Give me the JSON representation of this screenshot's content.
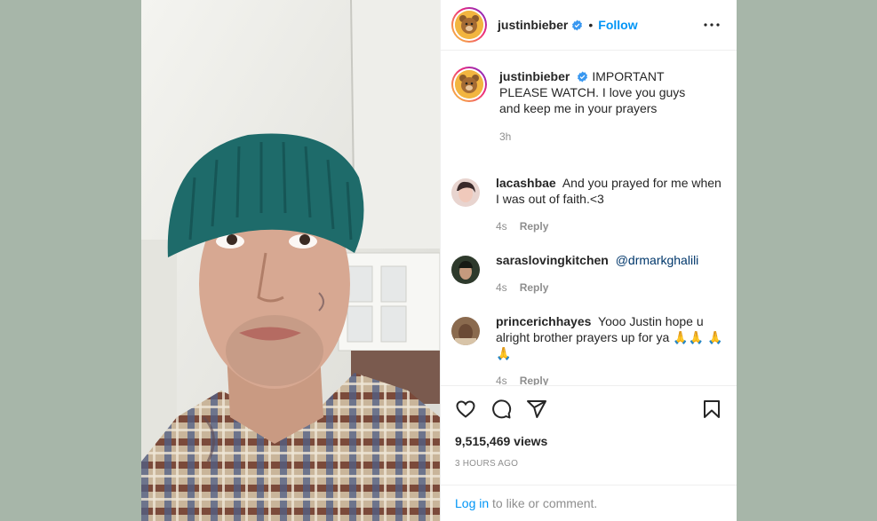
{
  "post": {
    "username": "justinbieber",
    "follow_label": "Follow",
    "dot": "•",
    "caption": {
      "username": "justinbieber",
      "text": "IMPORTANT PLEASE WATCH. I love you guys and keep me in your prayers",
      "time": "3h"
    },
    "comments": [
      {
        "username": "lacashbae",
        "text": "And you prayed for me when I was out of faith.<3",
        "mention": "",
        "time": "4s",
        "reply": "Reply"
      },
      {
        "username": "saraslovingkitchen",
        "text": "",
        "mention": "@drmarkghalili",
        "time": "4s",
        "reply": "Reply"
      },
      {
        "username": "princerichhayes",
        "text": "Yooo Justin hope u alright brother prayers up for ya 🙏🙏 🙏🙏",
        "mention": "",
        "time": "4s",
        "reply": "Reply"
      }
    ],
    "views": "9,515,469 views",
    "posted": "3 HOURS AGO",
    "login_link": "Log in",
    "login_text": " to like or comment."
  },
  "colors": {
    "background": "#a7b6a9",
    "accent": "#0095f6",
    "verified": "#3897f0",
    "muted": "#8e8e8e"
  },
  "icons": [
    "more-horizontal-icon",
    "verified-badge-icon",
    "heart-icon",
    "comment-icon",
    "share-icon",
    "bookmark-icon"
  ]
}
